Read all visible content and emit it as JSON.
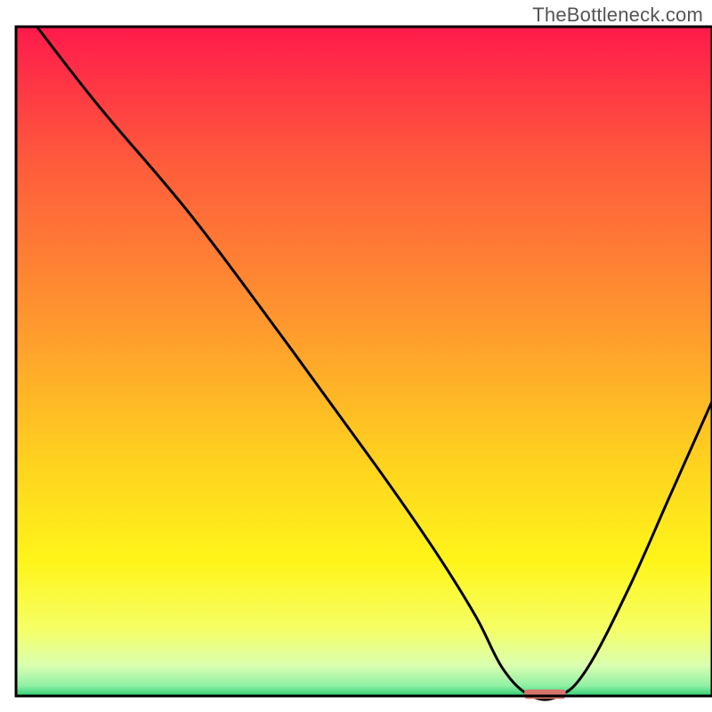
{
  "watermark": "TheBottleneck.com",
  "chart_data": {
    "type": "line",
    "title": "",
    "xlabel": "",
    "ylabel": "",
    "xlim": [
      0,
      100
    ],
    "ylim": [
      0,
      100
    ],
    "grid": false,
    "legend": false,
    "series": [
      {
        "name": "curve",
        "x": [
          3,
          12,
          25,
          38,
          52,
          60,
          66,
          70,
          74,
          78,
          82,
          88,
          94,
          100
        ],
        "y": [
          100,
          88,
          72,
          54,
          34,
          22,
          12,
          4,
          0,
          0,
          4,
          16,
          30,
          44
        ]
      }
    ],
    "marker": {
      "x": 76,
      "y": 0,
      "color": "#d9746c",
      "width": 6,
      "height": 1.4
    },
    "gradient_stops": [
      {
        "offset": 0.0,
        "color": "#ff1a4b"
      },
      {
        "offset": 0.2,
        "color": "#ff5a3c"
      },
      {
        "offset": 0.45,
        "color": "#ff9a2e"
      },
      {
        "offset": 0.65,
        "color": "#ffd21f"
      },
      {
        "offset": 0.8,
        "color": "#fff51a"
      },
      {
        "offset": 0.9,
        "color": "#f5ff66"
      },
      {
        "offset": 0.955,
        "color": "#d9ffb0"
      },
      {
        "offset": 0.985,
        "color": "#8ff0a4"
      },
      {
        "offset": 1.0,
        "color": "#2ecc71"
      }
    ],
    "frame": {
      "stroke": "#000000",
      "stroke_width": 3
    }
  }
}
